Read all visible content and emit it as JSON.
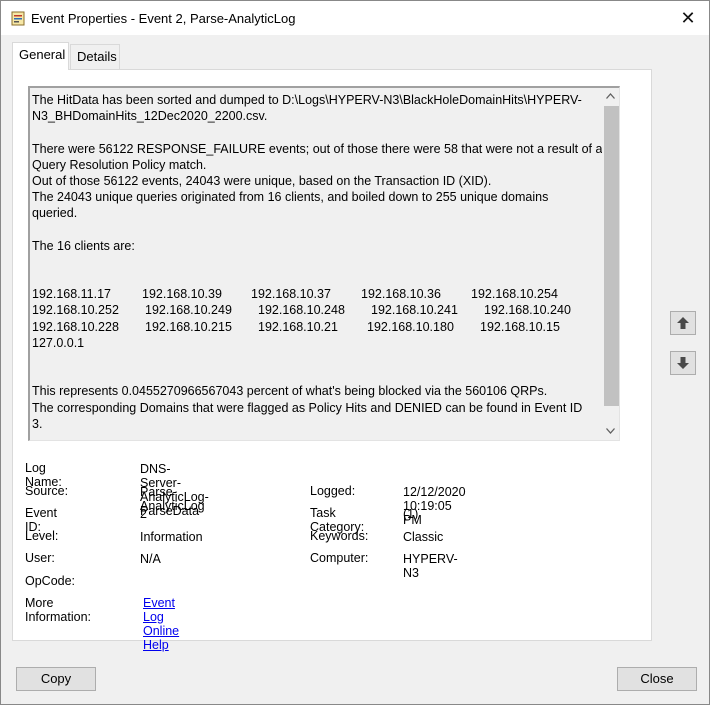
{
  "window": {
    "title": "Event Properties - Event 2, Parse-AnalyticLog",
    "close_glyph": "✕"
  },
  "tabs": [
    {
      "label": "General",
      "active": true
    },
    {
      "label": "Details",
      "active": false
    }
  ],
  "description": {
    "lines": [
      "The HitData has been sorted and dumped to D:\\Logs\\HYPERV-N3\\BlackHoleDomainHits\\HYPERV-",
      "N3_BHDomainHits_12Dec2020_2200.csv.",
      "",
      "There were 56122 RESPONSE_FAILURE events; out of those there were 58 that were not a result of a",
      "Query Resolution Policy match.",
      "Out of those 56122 events, 24043 were unique, based on the Transaction ID (XID).",
      "The 24043 unique queries originated from 16 clients, and boiled down to 255 unique domains",
      "queried.",
      "",
      "The 16 clients are:",
      "",
      ""
    ],
    "clients": [
      [
        "192.168.11.17",
        "192.168.10.39",
        "192.168.10.37",
        "192.168.10.36",
        "192.168.10.254"
      ],
      [
        "192.168.10.252",
        "192.168.10.249",
        "192.168.10.248",
        "192.168.10.241",
        "192.168.10.240"
      ],
      [
        "192.168.10.228",
        "192.168.10.215",
        "192.168.10.21",
        "192.168.10.180",
        "192.168.10.15"
      ],
      [
        "127.0.0.1"
      ]
    ],
    "tail_lines": [
      "",
      "",
      "This represents 0.0455270966567043 percent of what's being blocked via the 560106 QRPs.",
      "The corresponding Domains that were flagged as Policy Hits and DENIED can be found in Event ID",
      "3."
    ]
  },
  "properties": {
    "log_name_label": "Log Name:",
    "log_name": "DNS-Server-AnalyticLog-ParseData",
    "source_label": "Source:",
    "source": "Parse-AnalyticLog",
    "logged_label": "Logged:",
    "logged": "12/12/2020 10:19:05 PM",
    "event_id_label": "Event ID:",
    "event_id": "2",
    "task_category_label": "Task Category:",
    "task_category": "(1)",
    "level_label": "Level:",
    "level": "Information",
    "keywords_label": "Keywords:",
    "keywords": "Classic",
    "user_label": "User:",
    "user": "N/A",
    "computer_label": "Computer:",
    "computer": "HYPERV-N3",
    "opcode_label": "OpCode:",
    "opcode": "",
    "more_info_label": "More Information:",
    "more_info_link": "Event Log Online Help"
  },
  "buttons": {
    "copy": "Copy",
    "close": "Close"
  },
  "icons": {
    "app": "event-viewer-icon",
    "up": "arrow-up-icon",
    "down": "arrow-down-icon"
  }
}
